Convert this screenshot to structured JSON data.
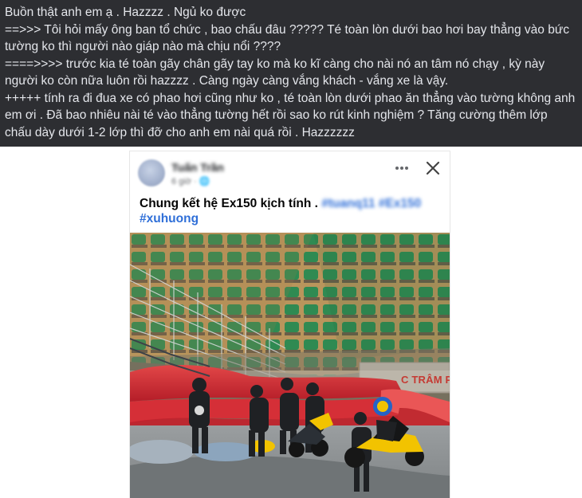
{
  "post": {
    "lines": [
      "Buồn thật anh em ạ . Hazzzz . Ngủ ko được",
      "==>>> Tôi hỏi mấy ông ban tổ chức , bao chấu đâu ????? Té toàn lòn dưới bao hơi bay thẳng vào bức tường ko thì người nào giáp nào mà chịu nổi ????",
      "====>>>> trước kia té toàn gãy chân gãy tay ko mà ko kĩ càng cho nài nó an tâm nó chạy , kỳ này người ko còn nữa luôn rồi hazzzz . Càng ngày càng vắng khách - vắng xe là vậy.",
      "+++++ tính ra đi đua xe có phao hơi cũng như ko , té toàn lòn dưới phao ăn thẳng vào tường không anh em ơi . Đã bao nhiêu nài té vào thẳng tường hết rồi sao ko rút kinh nghiệm ? Tăng cường thêm lớp chấu dày dưới 1-2 lớp thì đỡ cho anh em nài quá rồi . Hazzzzzz"
    ]
  },
  "embedded_post": {
    "author_name": "Tuấn Trần",
    "meta": "6 giờ · 🌐",
    "title": "Chung kết hệ Ex150 kịch tính . ",
    "blurred_tags": "#tuanq11 #Ex150",
    "hashtag": "#xuhuong",
    "photo": {
      "banner_text": "C TRÂM PHÚ Q"
    }
  },
  "colors": {
    "post_background": "#2d2e32",
    "post_text": "#e4e6eb",
    "hashtag": "#2f6fd8",
    "air_barrier": "#c9262f",
    "seats": "#2f8a52"
  },
  "icons": {
    "more": "more-options-icon",
    "close": "close-icon"
  }
}
